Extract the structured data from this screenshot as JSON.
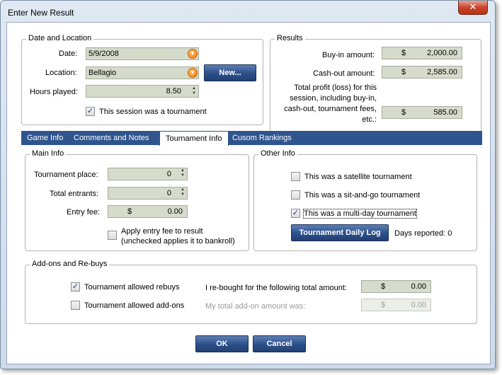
{
  "window": {
    "title": "Enter New Result",
    "close_glyph": "✕"
  },
  "date_location": {
    "legend": "Date and Location",
    "date_label": "Date:",
    "date_value": "5/9/2008",
    "location_label": "Location:",
    "location_value": "Bellagio",
    "new_button": "New...",
    "hours_label": "Hours played:",
    "hours_value": "8.50",
    "tournament_checkbox_label": "This session was a tournament",
    "tournament_checked": true
  },
  "results": {
    "legend": "Results",
    "buyin_label": "Buy-in amount:",
    "buyin_currency": "$",
    "buyin_value": "2,000.00",
    "cashout_label": "Cash-out amount:",
    "cashout_currency": "$",
    "cashout_value": "2,585.00",
    "profit_label_1": "Total profit (loss) for this",
    "profit_label_2": "session, including buy-in,",
    "profit_label_3": "cash-out, tournament fees,",
    "profit_label_4": "etc.:",
    "profit_currency": "$",
    "profit_value": "585.00"
  },
  "tabs": [
    {
      "label": "Game Info",
      "active": false
    },
    {
      "label": "Comments and Notes",
      "active": false
    },
    {
      "label": "Tournament Info",
      "active": true
    },
    {
      "label": "Cusom Rankings",
      "active": false
    }
  ],
  "main_info": {
    "legend": "Main Info",
    "place_label": "Tournament place:",
    "place_value": "0",
    "entrants_label": "Total entrants:",
    "entrants_value": "0",
    "fee_label": "Entry fee:",
    "fee_currency": "$",
    "fee_value": "0.00",
    "apply_fee_label_1": "Apply entry fee to result",
    "apply_fee_label_2": "(unchecked applies it to bankroll)"
  },
  "other_info": {
    "legend": "Other Info",
    "satellite_label": "This was a satellite tournament",
    "sitngo_label": "This was a sit-and-go tournament",
    "multiday_label": "This was a multi-day tournament",
    "daily_log_button": "Tournament Daily Log",
    "days_reported_label": "Days reported: 0"
  },
  "addons": {
    "legend": "Add-ons and Re-buys",
    "rebuys_label": "Tournament allowed rebuys",
    "addons_label": "Tournament allowed add-ons",
    "rebought_label": "I re-bought for the following total amount:",
    "rebought_currency": "$",
    "rebought_value": "0.00",
    "addon_amount_label": "My total add-on amount was:",
    "addon_currency": "$",
    "addon_value": "0.00"
  },
  "buttons": {
    "ok": "OK",
    "cancel": "Cancel"
  },
  "glyphs": {
    "check": "✓",
    "dropdown": "▼",
    "spin_up": "▲",
    "spin_down": "▼"
  }
}
